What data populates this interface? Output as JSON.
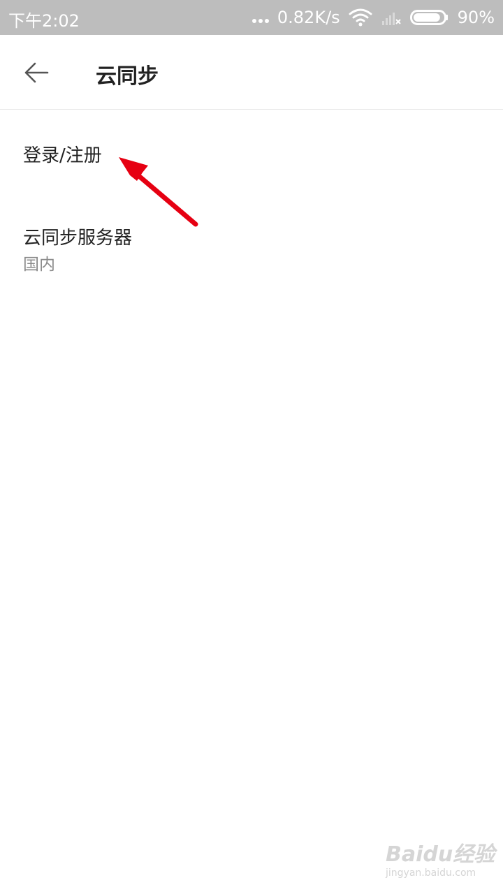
{
  "status_bar": {
    "time": "下午2:02",
    "network_speed": "0.82K/s",
    "battery_percent": "90%",
    "battery_level": 0.9,
    "icons": [
      "more-dots-icon",
      "wifi-icon",
      "signal-off-icon",
      "battery-icon"
    ]
  },
  "header": {
    "title": "云同步",
    "back_icon": "arrow-left-icon"
  },
  "list": {
    "items": [
      {
        "title": "登录/注册"
      },
      {
        "title": "云同步服务器",
        "subtitle": "国内"
      }
    ]
  },
  "annotation": {
    "arrow_color": "#e60012"
  },
  "watermark": {
    "logo": "Baidu经验",
    "site": "jingyan.baidu.com"
  },
  "colors": {
    "status_bar_bg": "#bdbdbd",
    "text_primary": "#222222",
    "text_secondary": "#8a8a8a",
    "divider": "#e6e6e6"
  }
}
